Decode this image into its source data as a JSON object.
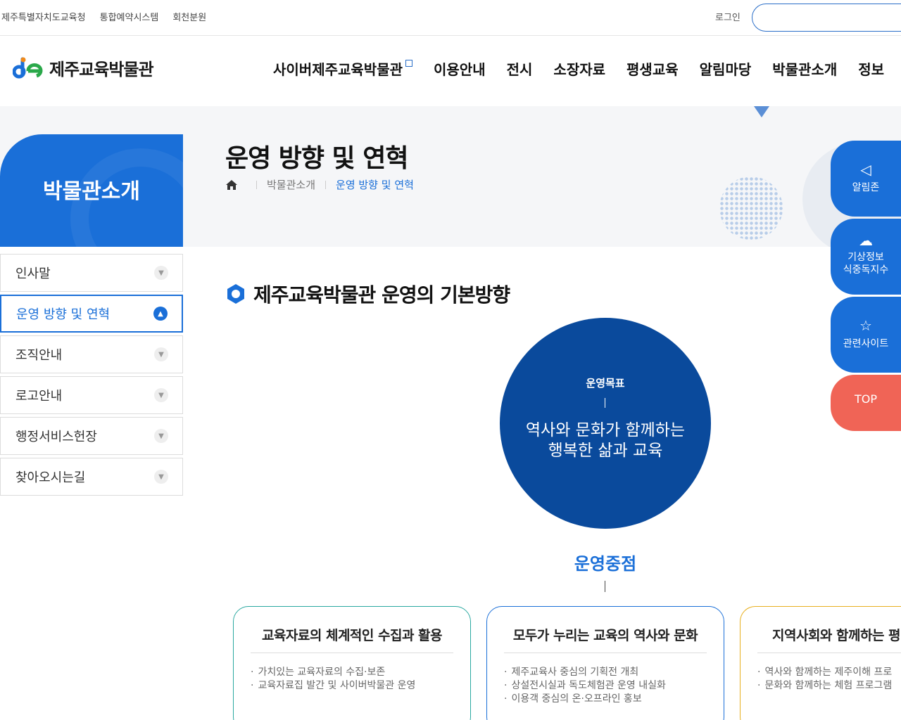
{
  "util": {
    "links": [
      "제주특별자치도교육청",
      "통합예약시스템",
      "회천분원"
    ],
    "login": "로그인"
  },
  "logo": {
    "text": "제주교육박물관"
  },
  "gnb": [
    "사이버제주교육박물관",
    "이용안내",
    "전시",
    "소장자료",
    "평생교육",
    "알림마당",
    "박물관소개",
    "정보"
  ],
  "side": {
    "title": "박물관소개"
  },
  "page": {
    "title": "운영 방향 및 연혁"
  },
  "breadcrumb": [
    "박물관소개",
    "운영 방향 및 연혁"
  ],
  "lnb": [
    {
      "label": "인사말",
      "active": false
    },
    {
      "label": "운영 방향 및 연혁",
      "active": true
    },
    {
      "label": "조직안내",
      "active": false
    },
    {
      "label": "로고안내",
      "active": false
    },
    {
      "label": "행정서비스헌장",
      "active": false
    },
    {
      "label": "찾아오시는길",
      "active": false
    }
  ],
  "content": {
    "section_title": "제주교육박물관 운영의 기본방향",
    "goal_label": "운영목표",
    "goal_text_1": "역사와 문화가 함께하는",
    "goal_text_2": "행복한 삶과 교육",
    "focus_title": "운영중점",
    "cards": [
      {
        "title": "교육자료의 체계적인 수집과 활용",
        "items": [
          "가치있는 교육자료의 수집·보존",
          "교육자료집 발간 및 사이버박물관 운영"
        ]
      },
      {
        "title": "모두가 누리는 교육의 역사와 문화",
        "items": [
          "제주교육사 중심의 기획전 개최",
          "상설전시실과 독도체험관 운영 내실화",
          "이용객 중심의 온·오프라인 홍보"
        ]
      },
      {
        "title": "지역사회와 함께하는 평",
        "items": [
          "역사와 함께하는 제주이해 프로",
          "문화와 함께하는 체험 프로그램"
        ]
      }
    ]
  },
  "quick": {
    "alarm": "알림존",
    "weather_1": "기상정보",
    "weather_2": "식중독지수",
    "sites": "관련사이트",
    "top": "TOP"
  },
  "colors": {
    "primary": "#1a6fd8",
    "goal": "#0a4a9c",
    "top": "#f06456",
    "teal": "#2aa8a0",
    "gold": "#e8b020"
  }
}
